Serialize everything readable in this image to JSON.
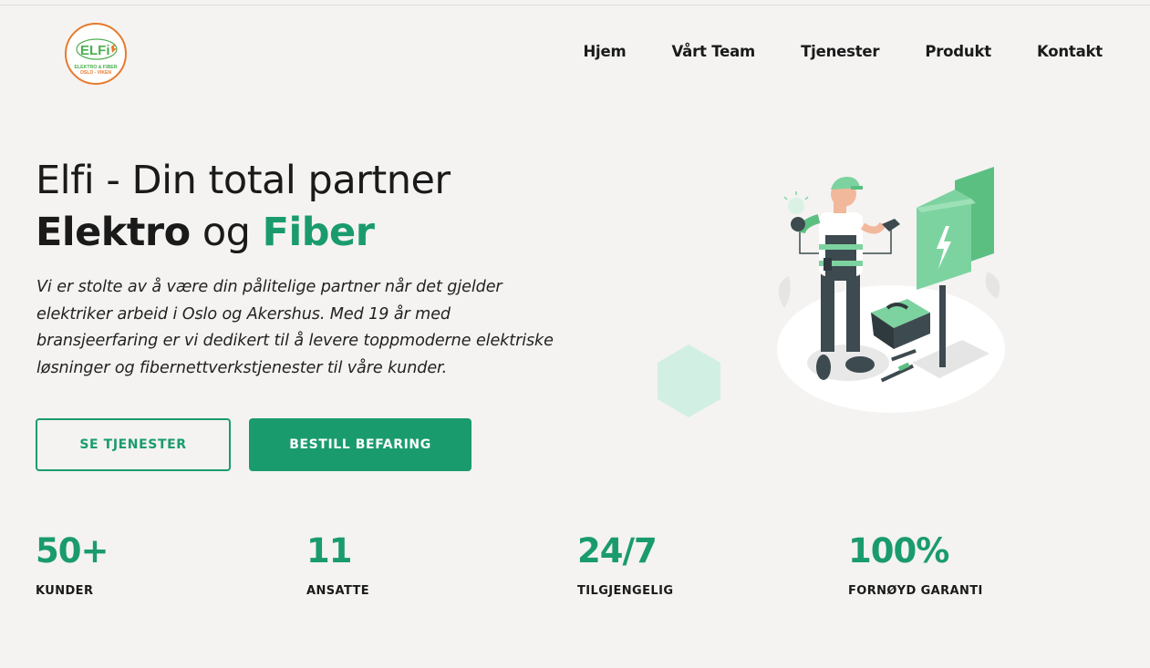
{
  "logo": {
    "name": "ELFi",
    "line1": "ELEKTRO & FIBER",
    "line2": "OSLO - VIKEN",
    "colors": {
      "ring": "#e87a2e",
      "text": "#4caf50"
    }
  },
  "nav": {
    "items": [
      {
        "label": "Hjem"
      },
      {
        "label": "Vårt Team"
      },
      {
        "label": "Tjenester"
      },
      {
        "label": "Produkt"
      },
      {
        "label": "Kontakt"
      }
    ]
  },
  "hero": {
    "title_line1": "Elfi - Din total partner",
    "title_word1": "Elektro",
    "title_word2": " og ",
    "title_word3": "Fiber",
    "description": "Vi er stolte av å være din pålitelige partner når det gjelder elektriker arbeid i Oslo og Akershus. Med 19 år med bransjeerfaring er vi dedikert til å levere toppmoderne elektriske løsninger og fibernettverkstjenester til våre kunder.",
    "button_secondary": "SE TJENESTER",
    "button_primary": "BESTILL BEFARING"
  },
  "stats": [
    {
      "value": "50+",
      "label": "KUNDER"
    },
    {
      "value": "11",
      "label": "ANSATTE"
    },
    {
      "value": "24/7",
      "label": "TILGJENGELIG"
    },
    {
      "value": "100%",
      "label": "FORNØYD GARANTI"
    }
  ],
  "illustration": {
    "icon": "electrician-illustration",
    "colors": {
      "accent": "#1a9b6e",
      "light_green": "#7dd3a0",
      "dark": "#3d4a4f"
    }
  },
  "colors": {
    "accent": "#1a9b6e",
    "background": "#f4f3f1",
    "text": "#1a1a1a"
  }
}
